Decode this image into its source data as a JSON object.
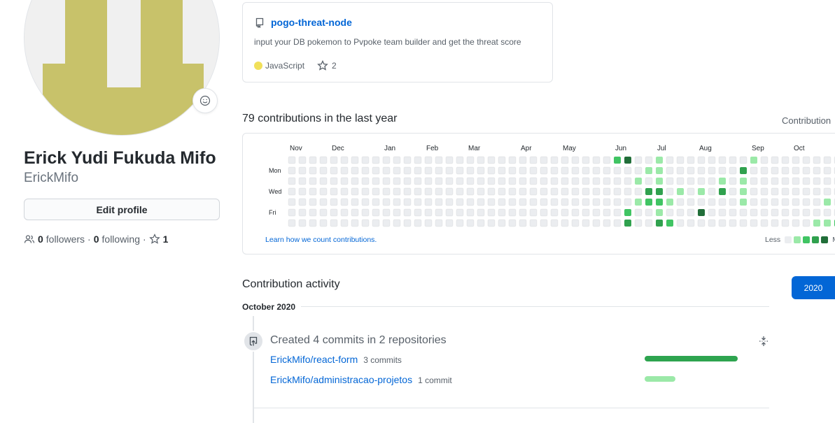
{
  "profile": {
    "name": "Erick Yudi Fukuda Mifo",
    "login": "ErickMifo",
    "edit_label": "Edit profile",
    "followers_count": "0",
    "followers_label": "followers",
    "following_count": "0",
    "following_label": "following",
    "separator": "·",
    "stars_count": "1",
    "avatar_color": "#c8c26a"
  },
  "pinned": {
    "repo_name": "pogo-threat-node",
    "description": "input your DB pokemon to Pvpoke team builder and get the threat score",
    "language": "JavaScript",
    "language_color": "#f1e05a",
    "stars": "2"
  },
  "contributions": {
    "title": "79 contributions in the last year",
    "settings_label": "Contribution",
    "months": [
      "Nov",
      "Dec",
      "Jan",
      "Feb",
      "Mar",
      "Apr",
      "May",
      "Jun",
      "Jul",
      "Aug",
      "Sep",
      "Oct"
    ],
    "days": [
      "Mon",
      "Wed",
      "Fri"
    ],
    "learn_link": "Learn how we count contributions.",
    "legend_less": "Less",
    "legend_more": "M",
    "colors": [
      "#ebedf0",
      "#9be9a8",
      "#40c463",
      "#30a14e",
      "#216e39"
    ]
  },
  "activity": {
    "title": "Contribution activity",
    "year": "2020",
    "month": "October 2020",
    "summary": "Created 4 commits in 2 repositories",
    "repos": [
      {
        "name": "ErickMifo/react-form",
        "count": "3 commits",
        "fraction": 1.0,
        "color": "#2ea44f"
      },
      {
        "name": "ErickMifo/administracao-projetos",
        "count": "1 commit",
        "fraction": 0.33,
        "color": "#9be9a8"
      }
    ]
  }
}
